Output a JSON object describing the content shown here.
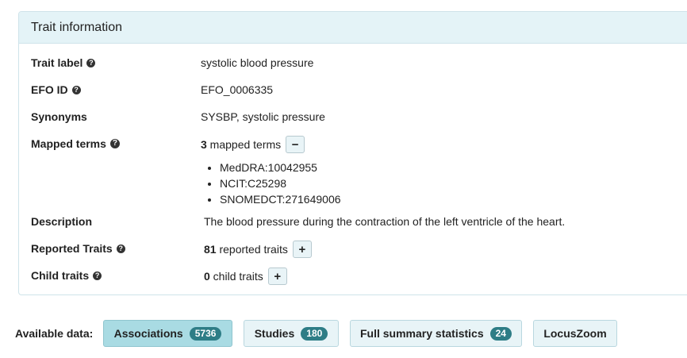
{
  "panel": {
    "title": "Trait information"
  },
  "fields": {
    "trait_label": {
      "label": "Trait label",
      "value": "systolic blood pressure"
    },
    "efo_id": {
      "label": "EFO ID",
      "value": "EFO_0006335"
    },
    "synonyms": {
      "label": "Synonyms",
      "value": "SYSBP, systolic pressure"
    },
    "mapped_terms": {
      "label": "Mapped terms",
      "count": "3",
      "suffix": " mapped terms",
      "toggle": "−",
      "items": [
        "MedDRA:10042955",
        "NCIT:C25298",
        "SNOMEDCT:271649006"
      ]
    },
    "description": {
      "label": "Description",
      "value": "The blood pressure during the contraction of the left ventricle of the heart."
    },
    "reported_traits": {
      "label": "Reported Traits",
      "count": "81",
      "suffix": " reported traits",
      "toggle": "+"
    },
    "child_traits": {
      "label": "Child traits",
      "count": "0",
      "suffix": " child traits",
      "toggle": "+"
    }
  },
  "available_data": {
    "label": "Available data:",
    "buttons": [
      {
        "label": "Associations",
        "badge": "5736"
      },
      {
        "label": "Studies",
        "badge": "180"
      },
      {
        "label": "Full summary statistics",
        "badge": "24"
      },
      {
        "label": "LocusZoom"
      }
    ]
  },
  "colors": {
    "accent": "#2e7d86",
    "heading_bg": "#e4f3f7",
    "active_button": "#a9dbe3"
  }
}
